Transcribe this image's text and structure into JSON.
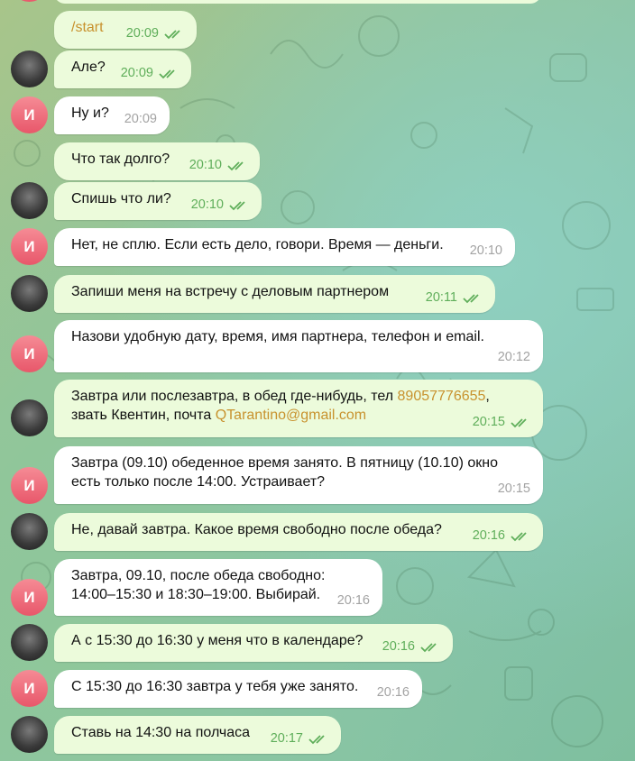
{
  "colors": {
    "outgoing_bubble": "#ecfbdb",
    "incoming_bubble": "#ffffff",
    "outgoing_time": "#5fae5a",
    "incoming_time": "#a3a3a3",
    "link": "#c8922e",
    "avatar_letter_bg": "#e8576a"
  },
  "bot_avatar_letter": "И",
  "messages": [
    {
      "text": "/start",
      "time": "20:09"
    },
    {
      "text": "Але?",
      "time": "20:09"
    },
    {
      "text": "Ну и?",
      "time": "20:09"
    },
    {
      "text": "Что так долго?",
      "time": "20:10"
    },
    {
      "text": "Спишь что ли?",
      "time": "20:10"
    },
    {
      "text": "Нет, не сплю. Если есть дело, говори. Время — деньги.",
      "time": "20:10"
    },
    {
      "text": "Запиши меня на встречу с деловым партнером",
      "time": "20:11"
    },
    {
      "text": "Назови удобную дату, время, имя партнера, телефон и email.",
      "time": "20:12"
    },
    {
      "text_a": "Завтра или послезавтра, в обед где-нибудь, тел ",
      "phone": "89057776655",
      "text_b": ",",
      "text_c": "звать Квентин, почта ",
      "email": "QTarantino@gmail.com",
      "time": "20:15"
    },
    {
      "text": "Завтра (09.10) обеденное время занято. В пятницу (10.10) окно\nесть только после 14:00. Устраивает?",
      "time": "20:15"
    },
    {
      "text": "Не, давай завтра. Какое время свободно после обеда?",
      "time": "20:16"
    },
    {
      "text": "Завтра, 09.10, после обеда свободно:\n14:00–15:30 и 18:30–19:00. Выбирай.",
      "time": "20:16"
    },
    {
      "text": "А с 15:30 до 16:30 у меня что в календаре?",
      "time": "20:16"
    },
    {
      "text": "С 15:30 до 16:30 завтра у тебя уже занято.",
      "time": "20:16"
    },
    {
      "text": "Ставь на 14:30 на полчаса",
      "time": "20:17"
    }
  ]
}
